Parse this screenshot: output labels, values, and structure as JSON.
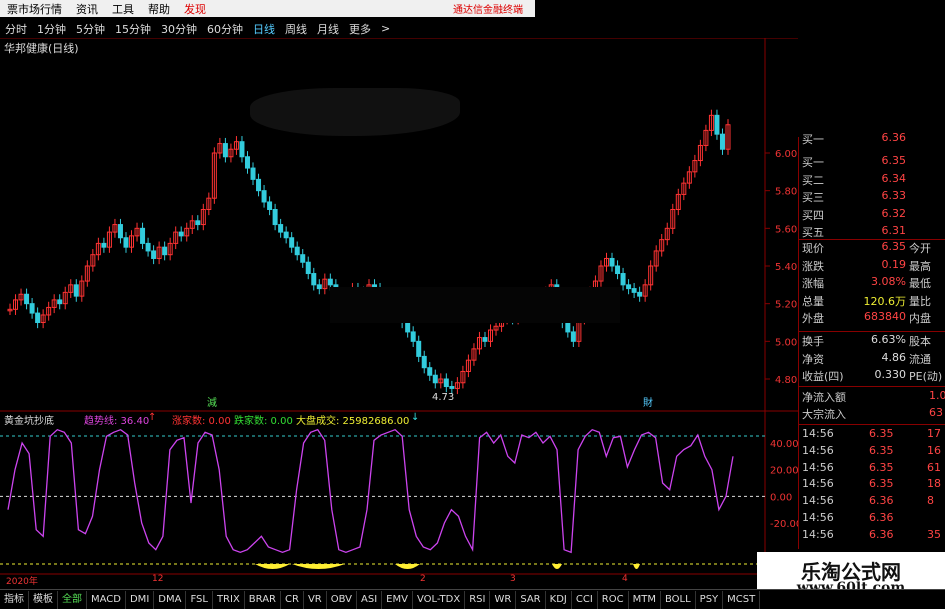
{
  "menu": {
    "items": [
      "票市场行情",
      "资讯",
      "工具",
      "帮助",
      "发现"
    ],
    "right_label": "通达信金融终端"
  },
  "periods": [
    "分时",
    "1分钟",
    "5分钟",
    "15分钟",
    "30分钟",
    "60分钟",
    "日线",
    "周线",
    "月线",
    "更多",
    ">"
  ],
  "active_period": "日线",
  "stock_title": "华邦健康(日线)",
  "price_axis": [
    "6.00",
    "5.80",
    "5.60",
    "5.40",
    "5.20",
    "5.00",
    "4.80"
  ],
  "low_marker": "4.73",
  "event_markers": [
    "減",
    "財"
  ],
  "indicator": {
    "name": "黄金坑抄底",
    "trend_label": "趋势线: 36.40",
    "trend_arrow": "↑",
    "up_count": "涨家数: 0.00",
    "down_count": "跌家数: 0.00",
    "market_vol": "大盘成交: 25982686.00",
    "market_arrow": "↓",
    "axis": [
      "40.00",
      "20.00",
      "0.00",
      "-20.00"
    ]
  },
  "order_book": {
    "partial_top": {
      "label": "买一",
      "price": "6.36"
    },
    "bids": [
      {
        "label": "买一",
        "price": "6.35"
      },
      {
        "label": "买二",
        "price": "6.34"
      },
      {
        "label": "买三",
        "price": "6.33"
      },
      {
        "label": "买四",
        "price": "6.32"
      },
      {
        "label": "买五",
        "price": "6.31"
      }
    ]
  },
  "quote": [
    {
      "label": "现价",
      "value": "6.35",
      "label2": "今开",
      "color": "#f44"
    },
    {
      "label": "涨跌",
      "value": "0.19",
      "label2": "最高",
      "color": "#f44"
    },
    {
      "label": "涨幅",
      "value": "3.08%",
      "label2": "最低",
      "color": "#f44"
    },
    {
      "label": "总量",
      "value": "120.6万",
      "label2": "量比",
      "color": "#ee3"
    },
    {
      "label": "外盘",
      "value": "683840",
      "label2": "内盘",
      "color": "#f44"
    }
  ],
  "quote2": [
    {
      "label": "换手",
      "value": "6.63%",
      "label2": "股本",
      "color": "#ddd"
    },
    {
      "label": "净资",
      "value": "4.86",
      "label2": "流通",
      "color": "#ddd"
    },
    {
      "label": "收益(四)",
      "value": "0.330",
      "label2": "PE(动)",
      "color": "#ddd"
    }
  ],
  "flows": [
    {
      "label": "净流入额",
      "value": "1.0"
    },
    {
      "label": "大宗流入",
      "value": "63"
    }
  ],
  "ticks": [
    {
      "time": "14:56",
      "price": "6.35",
      "vol": "17"
    },
    {
      "time": "14:56",
      "price": "6.35",
      "vol": "16"
    },
    {
      "time": "14:56",
      "price": "6.35",
      "vol": "61"
    },
    {
      "time": "14:56",
      "price": "6.35",
      "vol": "18"
    },
    {
      "time": "14:56",
      "price": "6.36",
      "vol": "8"
    },
    {
      "time": "14:56",
      "price": "6.36",
      "vol": ""
    },
    {
      "time": "14:56",
      "price": "6.36",
      "vol": "35"
    }
  ],
  "time_axis": [
    "2020年",
    "12",
    "2",
    "3",
    "4"
  ],
  "tabs": [
    "指标",
    "模板",
    "全部",
    "MACD",
    "DMI",
    "DMA",
    "FSL",
    "TRIX",
    "BRAR",
    "CR",
    "VR",
    "OBV",
    "ASI",
    "EMV",
    "VOL-TDX",
    "RSI",
    "WR",
    "SAR",
    "KDJ",
    "CCI",
    "ROC",
    "MTM",
    "BOLL",
    "PSY",
    "MCST"
  ],
  "active_tab": "全部",
  "watermark": {
    "line1": "乐淘公式网",
    "line2": "www.60lt.com"
  },
  "colors": {
    "up": "#ff3333",
    "down": "#33ccdd",
    "indicator_line": "#cc44ee",
    "fill": "#ffee33",
    "grid": "#880000"
  }
}
